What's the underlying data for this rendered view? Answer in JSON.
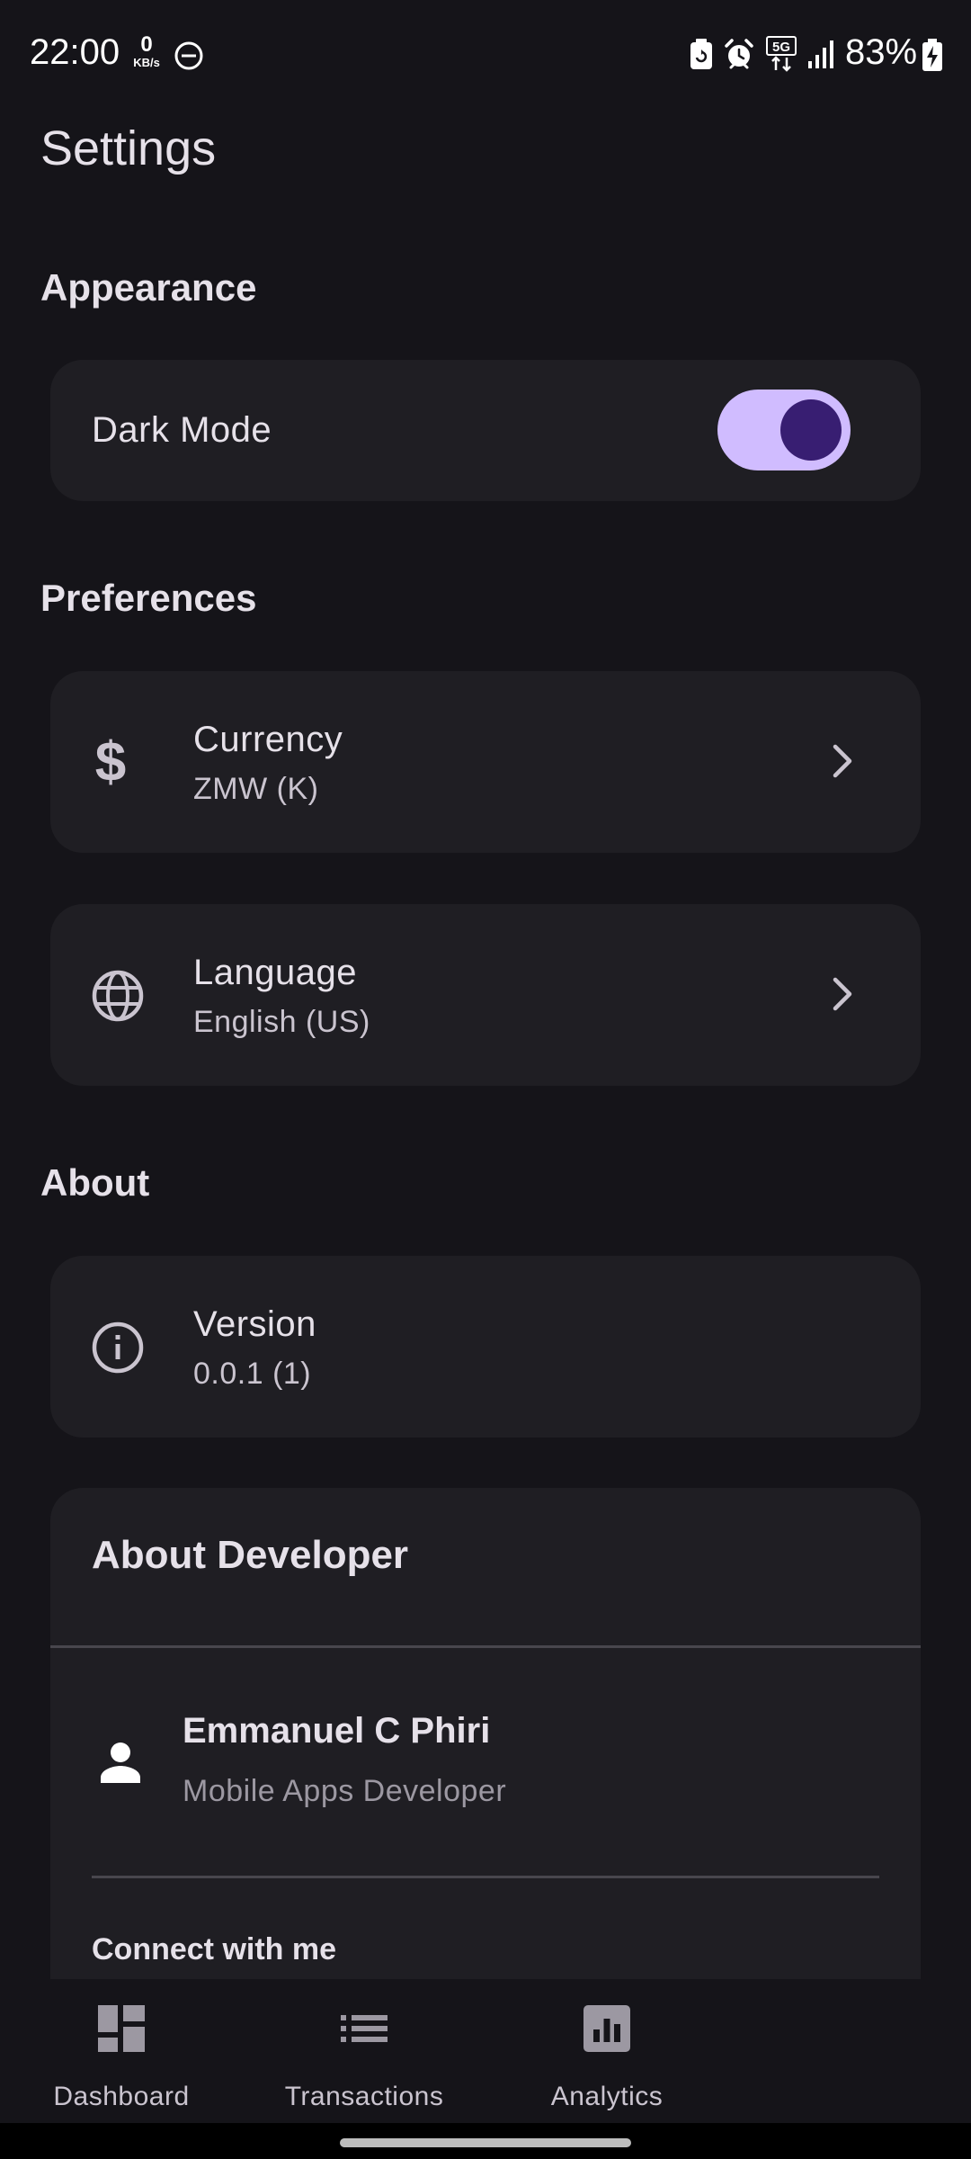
{
  "status_bar": {
    "time": "22:00",
    "net_speed_value": "0",
    "net_speed_unit": "KB/s",
    "network": "5G",
    "battery": "83%",
    "icons": [
      "do-not-disturb-icon",
      "battery-saver-icon",
      "alarm-icon",
      "5g-data-icon",
      "signal-icon",
      "battery-charging-icon"
    ]
  },
  "page": {
    "title": "Settings"
  },
  "appearance": {
    "section_title": "Appearance",
    "dark_mode": {
      "label": "Dark Mode",
      "enabled": true
    }
  },
  "preferences": {
    "section_title": "Preferences",
    "items": [
      {
        "icon": "dollar-icon",
        "title": "Currency",
        "subtitle": "ZMW (K)"
      },
      {
        "icon": "globe-icon",
        "title": "Language",
        "subtitle": "English (US)"
      }
    ]
  },
  "about": {
    "section_title": "About",
    "version": {
      "icon": "info-icon",
      "title": "Version",
      "subtitle": "0.0.1 (1)"
    }
  },
  "developer": {
    "card_title": "About Developer",
    "name": "Emmanuel C Phiri",
    "role": "Mobile Apps Developer",
    "connect_label": "Connect with me"
  },
  "bottom_nav": {
    "items": [
      {
        "icon": "dashboard-icon",
        "label": "Dashboard"
      },
      {
        "icon": "list-icon",
        "label": "Transactions"
      },
      {
        "icon": "analytics-icon",
        "label": "Analytics"
      }
    ]
  },
  "colors": {
    "background": "#151419",
    "card": "#1F1E23",
    "accent": "#D0BCFF",
    "accent_dark": "#381E72",
    "text": "#E6E1E9",
    "text_secondary": "#CAC4CF"
  }
}
